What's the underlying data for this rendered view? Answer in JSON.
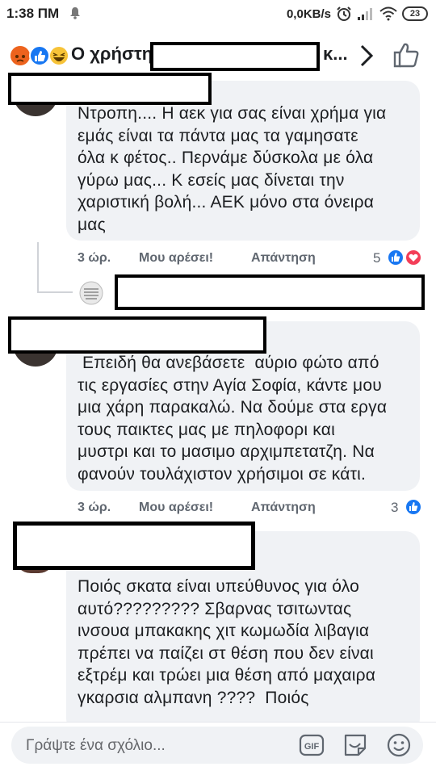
{
  "status_bar": {
    "time": "1:38 ΠΜ",
    "network_speed": "0,0KB/s",
    "battery": "23"
  },
  "header": {
    "title": "Ο χρήστης",
    "title_tail": "κ...",
    "icons": [
      "angry-reaction-icon",
      "like-reaction-icon",
      "haha-reaction-icon",
      "chevron-right-icon",
      "thumbs-up-icon"
    ]
  },
  "comments": [
    {
      "text_lines": [
        "Ντροπη.... Η αεκ για σας είναι χρήμα για",
        "εμάς είναι τα πάντα μας τα γαμησατε",
        "όλα κ φέτος.. Περνάμε δύσκολα με όλα",
        "γύρω μας... Κ εσείς μας δίνεται την",
        "χαριστική βολή... ΑΕΚ μόνο στα όνειρα",
        "μας"
      ],
      "time": "3 ώρ.",
      "like_label": "Μου αρέσει!",
      "reply_label": "Απάντηση",
      "reaction_count": "5"
    },
    {
      "text_lines": [
        " Επειδή θα ανεβάσετε  αύριο φώτο από",
        "τις εργασίες στην Αγία Σοφία, κάντε μου",
        "μια χάρη παρακαλώ. Να δούμε στα εργα",
        "τους παικτες μας με πηλοφορι και",
        "μυστρι και το μασιμο αρχιμπετατζη. Να",
        "φανούν τουλάχιστον χρήσιμοι σε κάτι."
      ],
      "time": "3 ώρ.",
      "like_label": "Μου αρέσει!",
      "reply_label": "Απάντηση",
      "reaction_count": "3"
    },
    {
      "text_lines": [
        "Ποιός σκατα είναι υπεύθυνος για όλο",
        "αυτό????????? Σβαρνας τσιτωντας",
        "ινσουα μπακακης χιτ κωμωδία λιβαγια",
        "πρέπει να παίζει στ θέση που δεν είναι",
        "εξτρέμ και τρώει μια θέση από μαχαιρα",
        "γκαρσια αλμπανη ????  Ποιός"
      ]
    }
  ],
  "composer": {
    "placeholder": "Γράψτε ένα σχόλιο...",
    "gif_label": "GIF"
  },
  "colors": {
    "like_blue": "#1877f2",
    "love_red": "#f33e58",
    "bubble_bg": "#f0f2f5",
    "meta_gray": "#606770"
  }
}
